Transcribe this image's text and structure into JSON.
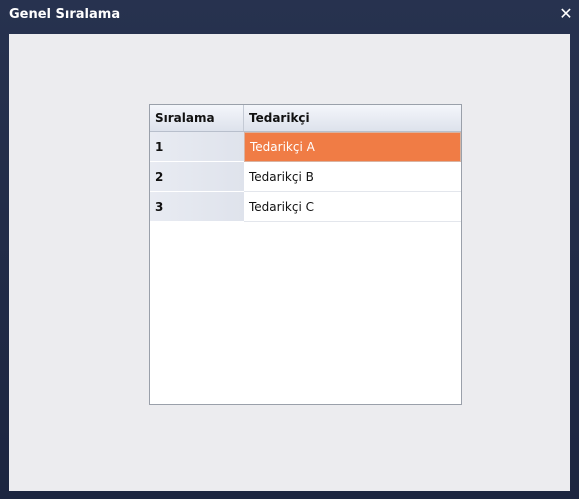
{
  "window": {
    "title": "Genel Sıralama",
    "close_glyph": "✕",
    "close_icon": "close-icon"
  },
  "grid": {
    "columns": [
      "Sıralama",
      "Tedarikçi"
    ],
    "rows": [
      {
        "rank": "1",
        "supplier": "Tedarikçi A",
        "selected": true
      },
      {
        "rank": "2",
        "supplier": "Tedarikçi B",
        "selected": false
      },
      {
        "rank": "3",
        "supplier": "Tedarikçi C",
        "selected": false
      }
    ]
  },
  "colors": {
    "selection": "#f07c45",
    "titlebar": "#27324f",
    "client": "#ececef"
  }
}
